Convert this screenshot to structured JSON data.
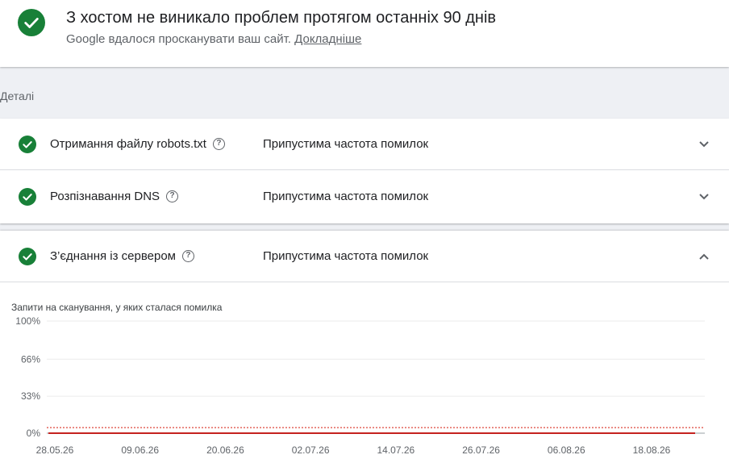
{
  "banner": {
    "title": "З хостом не виникало проблем протягом останніх 90 днів",
    "subtitle": "Google вдалося просканувати ваш сайт.",
    "link": "Докладніше",
    "icon": "check-circle-icon",
    "accent": "#188038"
  },
  "details_label": "Деталі",
  "rows": [
    {
      "name": "Отримання файлу robots.txt",
      "status": "Припустима частота помилок",
      "expanded": false
    },
    {
      "name": "Розпізнавання DNS",
      "status": "Припустима частота помилок",
      "expanded": false
    },
    {
      "name": "З’єднання із сервером",
      "status": "Припустима частота помилок",
      "expanded": true
    }
  ],
  "chart": {
    "title": "Запити на сканування, у яких сталася помилка"
  },
  "chart_data": {
    "type": "line",
    "title": "Запити на сканування, у яких сталася помилка",
    "ytick_labels": [
      "100%",
      "66%",
      "33%",
      "0%"
    ],
    "yticks": [
      100,
      66,
      33,
      0
    ],
    "ylim": [
      0,
      100
    ],
    "xtick_labels": [
      "28.05.26",
      "09.06.26",
      "20.06.26",
      "02.07.26",
      "14.07.26",
      "26.07.26",
      "06.08.26",
      "18.08.26"
    ],
    "threshold": {
      "value": 5,
      "color": "#d93025",
      "style": "dotted"
    },
    "series": [
      {
        "values": [
          0,
          0,
          0,
          0,
          0,
          0,
          0,
          0
        ],
        "color": "#c5221f"
      }
    ],
    "grid": true
  }
}
